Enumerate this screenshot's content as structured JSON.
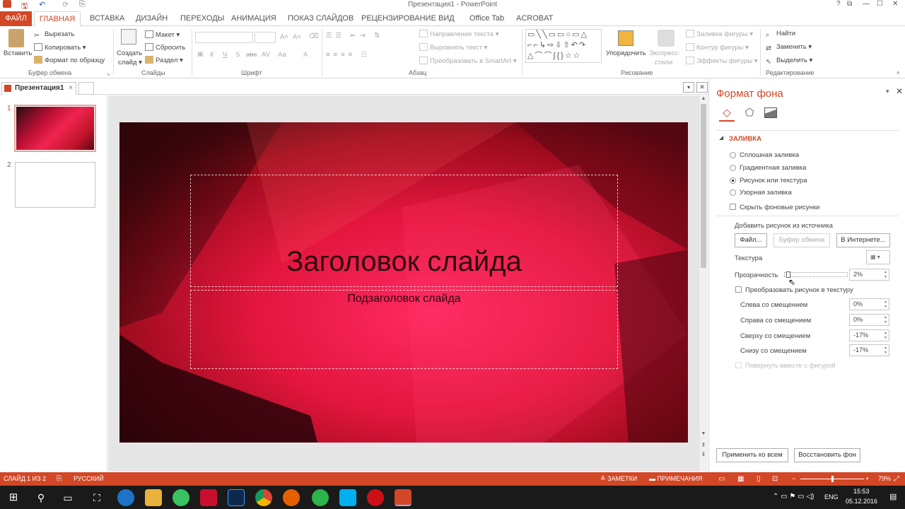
{
  "window": {
    "title": "Презентация1 - PowerPoint",
    "help": "?",
    "restore": "⧉",
    "minimize": "—",
    "maximize": "☐",
    "close": "✕"
  },
  "ribbon_tabs": [
    "ФАЙЛ",
    "ГЛАВНАЯ",
    "ВСТАВКА",
    "ДИЗАЙН",
    "ПЕРЕХОДЫ",
    "АНИМАЦИЯ",
    "ПОКАЗ СЛАЙДОВ",
    "РЕЦЕНЗИРОВАНИЕ",
    "ВИД",
    "Office Tab",
    "ACROBAT"
  ],
  "clipboard": {
    "paste": "Вставить",
    "cut": "Вырезать",
    "copy": "Копировать",
    "format_painter": "Формат по образцу",
    "label": "Буфер обмена"
  },
  "slides_grp": {
    "create": "Создать",
    "slide": "слайд",
    "layout": "Макет",
    "reset": "Сбросить",
    "section": "Раздел",
    "label": "Слайды"
  },
  "font_grp": {
    "label": "Шрифт",
    "bold": "Ж",
    "italic": "К",
    "underline": "Ч",
    "strike": "S",
    "abc": "abc",
    "av": "AV",
    "aa": "Aa",
    "a": "A",
    "grow": "A˄",
    "shrink": "A˅"
  },
  "paragraph_grp": {
    "text_direction": "Направление текста",
    "align_text": "Выровнять текст",
    "smartart": "Преобразовать в SmartArt",
    "label": "Абзац"
  },
  "drawing_grp": {
    "arrange": "Упорядочить",
    "quick_styles": "Экспресс-",
    "quick_styles2": "стили",
    "shape_fill": "Заливка фигуры",
    "shape_outline": "Контур фигуры",
    "shape_effects": "Эффекты фигуры",
    "label": "Рисование"
  },
  "editing_grp": {
    "find": "Найти",
    "replace": "Заменить",
    "select": "Выделить",
    "label": "Редактирование"
  },
  "doc_tab": "Презентация1",
  "thumbnails": [
    {
      "num": "1"
    },
    {
      "num": "2"
    }
  ],
  "slide": {
    "title": "Заголовок слайда",
    "subtitle": "Подзаголовок слайда"
  },
  "format_pane": {
    "title": "Формат фона",
    "section": "ЗАЛИВКА",
    "fill_options": [
      "Сплошная заливка",
      "Градиентная заливка",
      "Рисунок или текстура",
      "Узорная заливка"
    ],
    "selected_fill": 2,
    "hide_bg": "Скрыть фоновые рисунки",
    "insert_from": "Добавить рисунок из источника",
    "btn_file": "Файл...",
    "btn_clipboard": "Буфер обмена",
    "btn_online": "В Интернете...",
    "texture": "Текстура",
    "transparency": "Прозрачность",
    "transparency_value": "2%",
    "transparency_fraction": 0.02,
    "tile": "Преобразовать рисунок в текстуру",
    "offsets": [
      {
        "label": "Слева со смещением",
        "value": "0%"
      },
      {
        "label": "Справа со смещением",
        "value": "0%"
      },
      {
        "label": "Сверху со смещением",
        "value": "-17%"
      },
      {
        "label": "Снизу со смещением",
        "value": "-17%"
      }
    ],
    "rotate_with_shape": "Повернуть вместе с фигурой",
    "apply_all": "Применить ко всем",
    "reset_bg": "Восстановить фон"
  },
  "status": {
    "slide_info": "СЛАЙД 1 ИЗ 2",
    "language": "РУССКИЙ",
    "notes": "ЗАМЕТКИ",
    "comments": "ПРИМЕЧАНИЯ",
    "zoom": "79%",
    "zoom_fraction": 0.5
  },
  "taskbar": {
    "lang": "ENG",
    "time": "15:53",
    "date": "05.12.2016"
  },
  "colors": {
    "accent": "#d24726",
    "statusbar": "#d24726",
    "pane_title": "#d24726"
  }
}
